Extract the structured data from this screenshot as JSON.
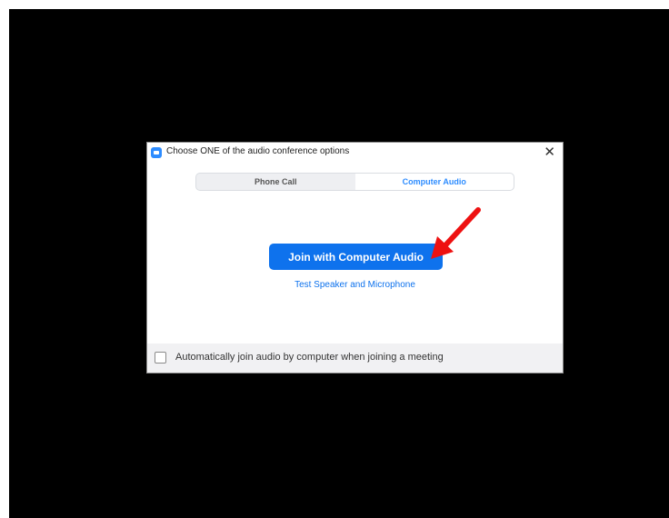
{
  "dialog": {
    "title": "Choose ONE of the audio conference options",
    "close_glyph": "✕",
    "tabs": [
      {
        "label": "Phone Call",
        "selected": false
      },
      {
        "label": "Computer Audio",
        "selected": true
      }
    ],
    "join_button_label": "Join with Computer Audio",
    "test_link_label": "Test Speaker and Microphone",
    "auto_join": {
      "label": "Automatically join audio by computer when joining a meeting",
      "checked": false
    }
  },
  "colors": {
    "accent": "#0e72ed",
    "annotation_arrow": "#ee1111",
    "background": "#000000"
  },
  "icons": {
    "app": "zoom-camera-icon",
    "close": "close-icon",
    "annotation": "red-arrow-icon"
  }
}
